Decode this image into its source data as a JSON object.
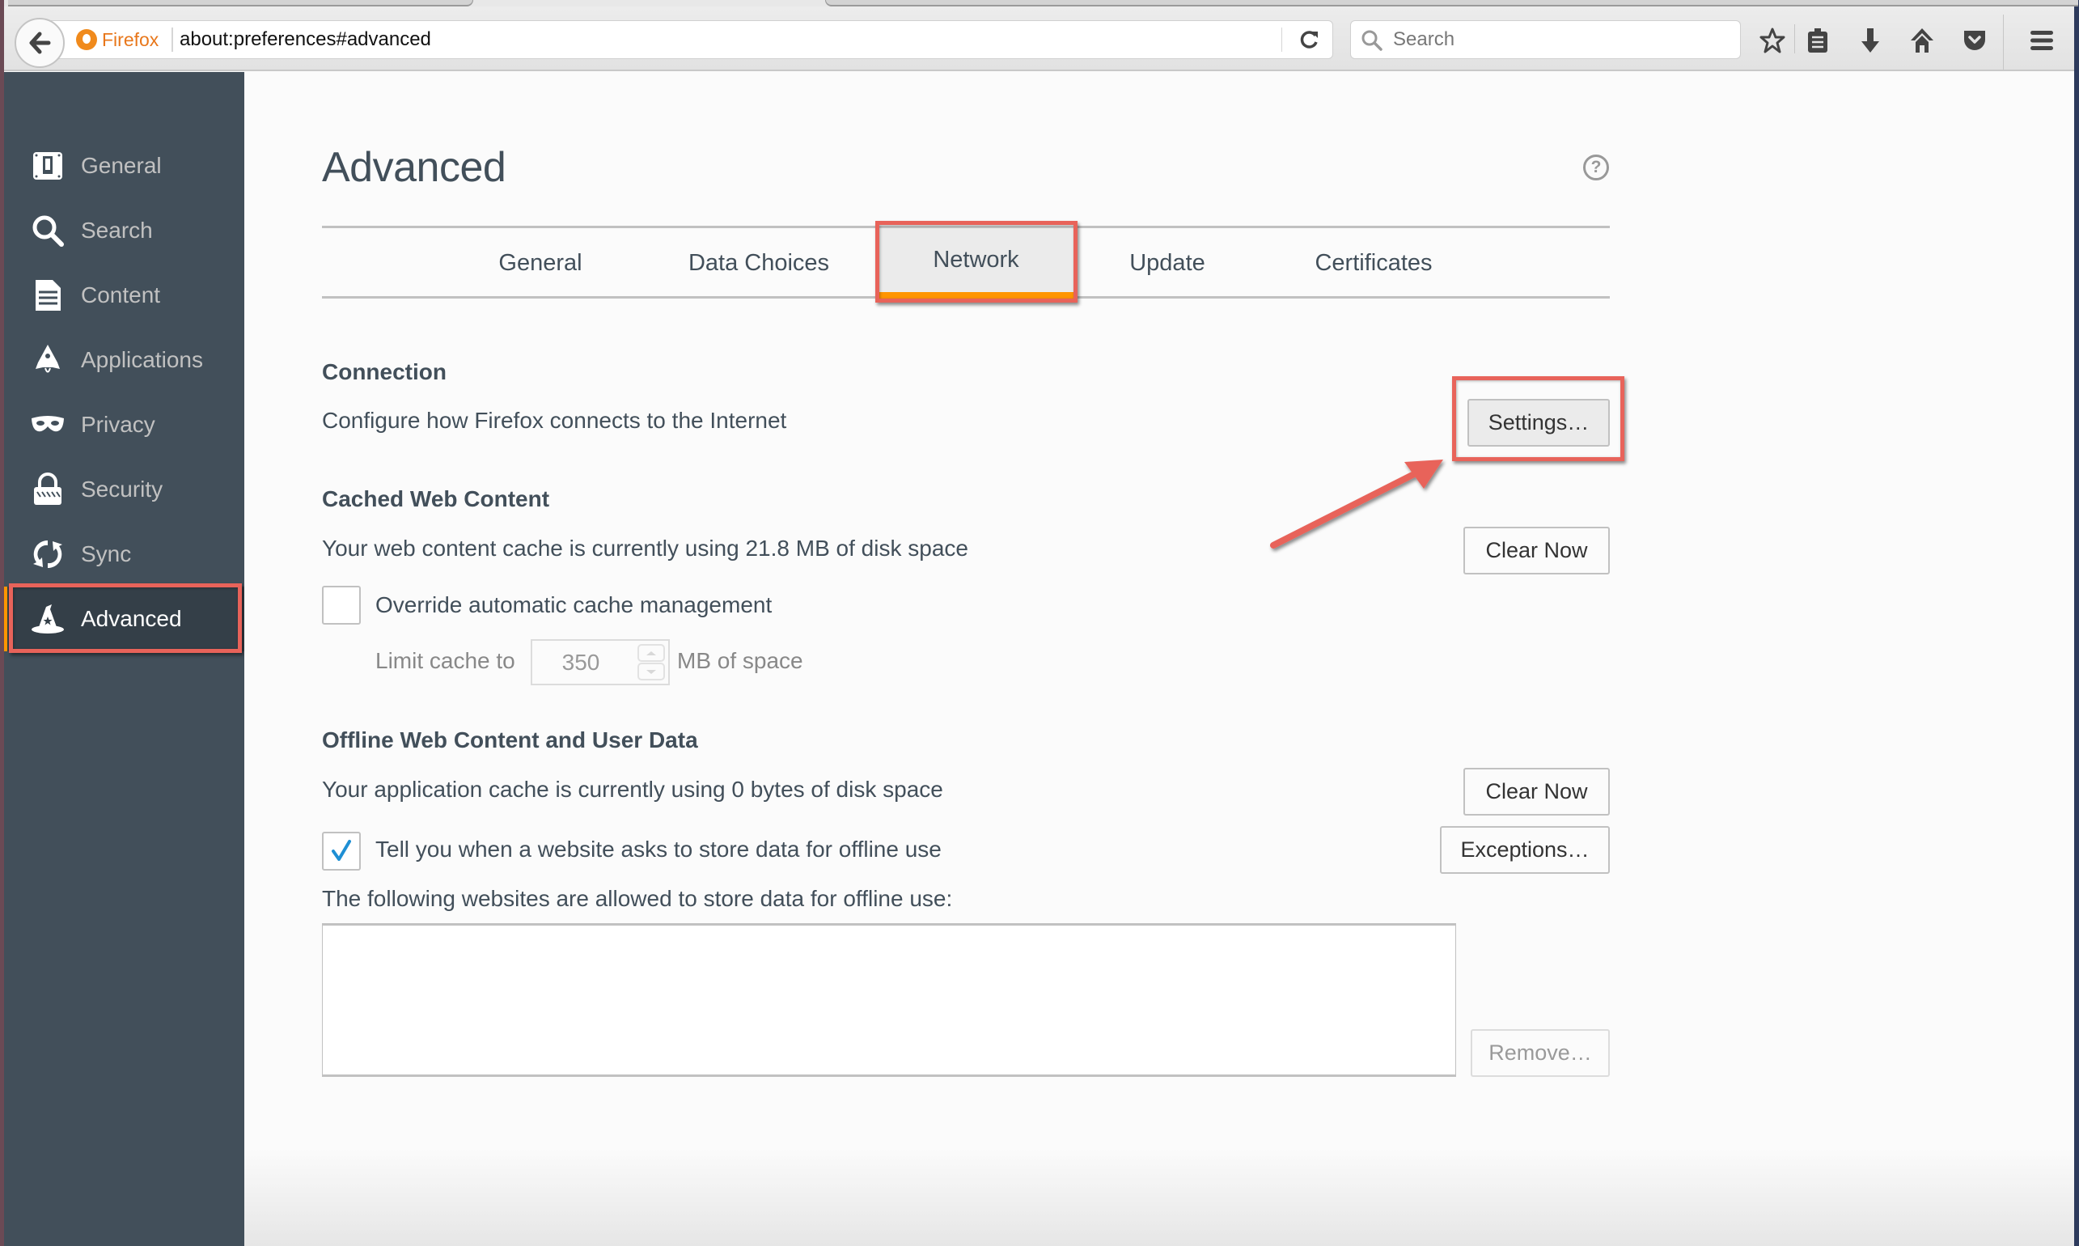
{
  "browser": {
    "identity_label": "Firefox",
    "url": "about:preferences#advanced",
    "search_placeholder": "Search",
    "toolbar_icons": [
      "back-icon",
      "reload-icon",
      "search-icon",
      "bookmark-star-icon",
      "reading-list-icon",
      "downloads-icon",
      "home-icon",
      "pocket-icon",
      "menu-icon"
    ]
  },
  "sidebar": {
    "items": [
      {
        "label": "General",
        "icon": "general-icon",
        "selected": false
      },
      {
        "label": "Search",
        "icon": "search-icon",
        "selected": false
      },
      {
        "label": "Content",
        "icon": "content-icon",
        "selected": false
      },
      {
        "label": "Applications",
        "icon": "applications-icon",
        "selected": false
      },
      {
        "label": "Privacy",
        "icon": "privacy-mask-icon",
        "selected": false
      },
      {
        "label": "Security",
        "icon": "security-lock-icon",
        "selected": false
      },
      {
        "label": "Sync",
        "icon": "sync-icon",
        "selected": false
      },
      {
        "label": "Advanced",
        "icon": "advanced-wizard-hat-icon",
        "selected": true
      }
    ]
  },
  "page": {
    "title": "Advanced",
    "help_icon_label": "?",
    "tabs": [
      {
        "label": "General",
        "selected": false
      },
      {
        "label": "Data Choices",
        "selected": false
      },
      {
        "label": "Network",
        "selected": true
      },
      {
        "label": "Update",
        "selected": false
      },
      {
        "label": "Certificates",
        "selected": false
      }
    ]
  },
  "connection": {
    "heading": "Connection",
    "description": "Configure how Firefox connects to the Internet",
    "settings_button": "Settings…"
  },
  "cached": {
    "heading": "Cached Web Content",
    "usage_text": "Your web content cache is currently using 21.8 MB of disk space",
    "clear_button": "Clear Now",
    "override_label": "Override automatic cache management",
    "override_checked": false,
    "limit_prefix": "Limit cache to",
    "limit_value": "350",
    "limit_suffix": "MB of space"
  },
  "offline": {
    "heading": "Offline Web Content and User Data",
    "usage_text": "Your application cache is currently using 0 bytes of disk space",
    "clear_button": "Clear Now",
    "tell_label": "Tell you when a website asks to store data for offline use",
    "tell_checked": true,
    "exceptions_button": "Exceptions…",
    "allowed_label": "The following websites are allowed to store data for offline use:",
    "allowed_sites": [],
    "remove_button": "Remove…"
  },
  "annotations": {
    "highlight_color": "#e8635a",
    "accent_color": "#ff9500"
  }
}
